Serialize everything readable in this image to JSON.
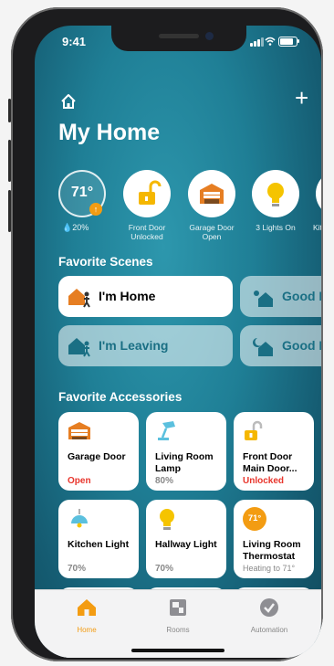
{
  "status_bar": {
    "time": "9:41"
  },
  "header": {
    "title": "My Home",
    "add_label": "+"
  },
  "climate": {
    "temperature": "71°",
    "humidity": "20%"
  },
  "status_items": [
    {
      "label": "Front Door Unlocked",
      "icon": "lock-icon"
    },
    {
      "label": "Garage Door Open",
      "icon": "garage-icon"
    },
    {
      "label": "3 Lights On",
      "icon": "lightbulb-icon"
    },
    {
      "label": "Kitch",
      "icon": "lightbulb-icon"
    }
  ],
  "scenes": {
    "heading": "Favorite Scenes",
    "items": [
      {
        "label": "I'm Home",
        "active": true
      },
      {
        "label": "Good M",
        "active": false
      },
      {
        "label": "I'm Leaving",
        "active": false
      },
      {
        "label": "Good N",
        "active": false
      }
    ]
  },
  "accessories": {
    "heading": "Favorite Accessories",
    "items": [
      {
        "name": "Garage Door",
        "status": "Open",
        "status_color": "#e8352c",
        "icon": "garage-icon"
      },
      {
        "name": "Living Room Lamp",
        "status": "80%",
        "status_color": "#888888",
        "icon": "desk-lamp-icon"
      },
      {
        "name": "Front Door Main Door...",
        "status": "Unlocked",
        "status_color": "#e8352c",
        "icon": "lock-icon"
      },
      {
        "name": "Kitchen Light",
        "status": "70%",
        "status_color": "#888888",
        "icon": "pendant-light-icon"
      },
      {
        "name": "Hallway Light",
        "status": "70%",
        "status_color": "#888888",
        "icon": "lightbulb-icon"
      },
      {
        "name": "Living Room Thermostat",
        "status": "Heating to 71°",
        "status_color": "#888888",
        "icon": "thermostat-icon",
        "badge": "71°"
      }
    ]
  },
  "tabs": [
    {
      "label": "Home",
      "active": true,
      "icon": "home-icon"
    },
    {
      "label": "Rooms",
      "active": false,
      "icon": "rooms-icon"
    },
    {
      "label": "Automation",
      "active": false,
      "icon": "automation-icon"
    }
  ],
  "colors": {
    "accent": "#f39c12",
    "alert": "#e8352c",
    "background": "#1f7f96"
  }
}
